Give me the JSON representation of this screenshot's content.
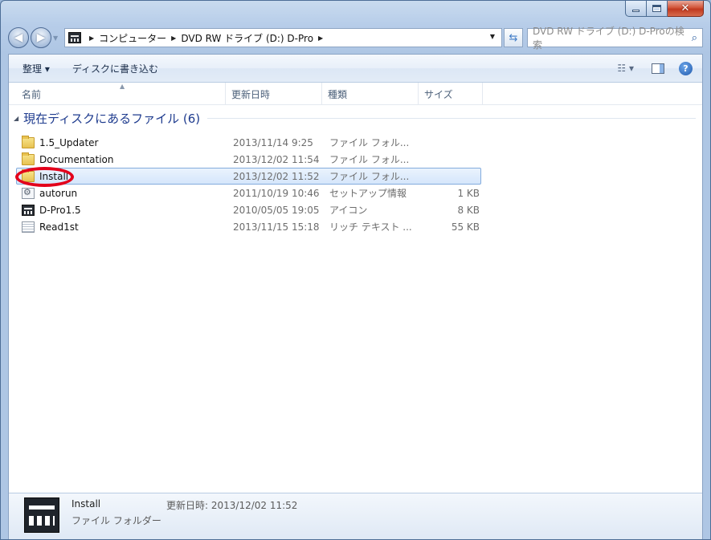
{
  "window": {
    "minimize_icon": "minimize-icon",
    "maximize_icon": "maximize-icon",
    "close_label": "✕"
  },
  "nav": {
    "back_glyph": "◀",
    "forward_glyph": "▶",
    "breadcrumbs": [
      "コンピューター",
      "DVD RW ドライブ (D:) D-Pro"
    ],
    "search_placeholder": "DVD RW ドライブ (D:) D-Proの検索"
  },
  "toolbar": {
    "organize_label": "整理 ▾",
    "burn_label": "ディスクに書き込む",
    "view_glyph": "☷ ▾",
    "help_glyph": "?"
  },
  "columns": {
    "name": "名前",
    "date": "更新日時",
    "type": "種類",
    "size": "サイズ"
  },
  "group": {
    "label": "現在ディスクにあるファイル (6)"
  },
  "files": [
    {
      "name": "1.5_Updater",
      "date": "2013/11/14 9:25",
      "type": "ファイル フォル...",
      "size": "",
      "icon": "folder"
    },
    {
      "name": "Documentation",
      "date": "2013/12/02 11:54",
      "type": "ファイル フォル...",
      "size": "",
      "icon": "folder"
    },
    {
      "name": "Install",
      "date": "2013/12/02 11:52",
      "type": "ファイル フォル...",
      "size": "",
      "icon": "folder"
    },
    {
      "name": "autorun",
      "date": "2011/10/19 10:46",
      "type": "セットアップ情報",
      "size": "1 KB",
      "icon": "setup"
    },
    {
      "name": "D-Pro1.5",
      "date": "2010/05/05 19:05",
      "type": "アイコン",
      "size": "8 KB",
      "icon": "dpro"
    },
    {
      "name": "Read1st",
      "date": "2013/11/15 15:18",
      "type": "リッチ テキスト ...",
      "size": "55 KB",
      "icon": "document"
    }
  ],
  "selected_index": 2,
  "details": {
    "name": "Install",
    "type": "ファイル フォルダー",
    "modified": "更新日時: 2013/12/02 11:52"
  },
  "colors": {
    "annotation": "#e3001b",
    "selection_border": "#84acdd"
  }
}
